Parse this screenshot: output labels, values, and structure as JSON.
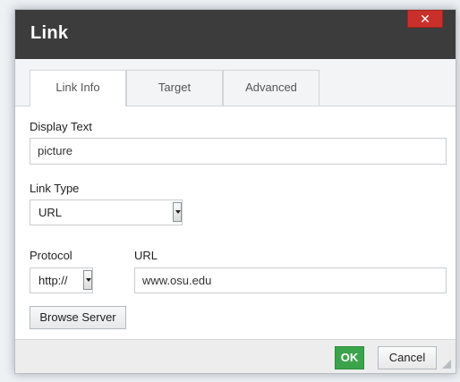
{
  "dialog": {
    "title": "Link",
    "close_glyph": "✕"
  },
  "tabs": [
    {
      "label": "Link Info",
      "active": true
    },
    {
      "label": "Target",
      "active": false
    },
    {
      "label": "Advanced",
      "active": false
    }
  ],
  "form": {
    "display_text": {
      "label": "Display Text",
      "value": "picture"
    },
    "link_type": {
      "label": "Link Type",
      "value": "URL"
    },
    "protocol": {
      "label": "Protocol",
      "value": "http://"
    },
    "url": {
      "label": "URL",
      "value": "www.osu.edu"
    },
    "browse_label": "Browse Server"
  },
  "footer": {
    "ok_label": "OK",
    "cancel_label": "Cancel"
  },
  "colors": {
    "titlebar": "#3c3c3c",
    "close_button": "#c9302c",
    "ok_button": "#3ba34b"
  }
}
